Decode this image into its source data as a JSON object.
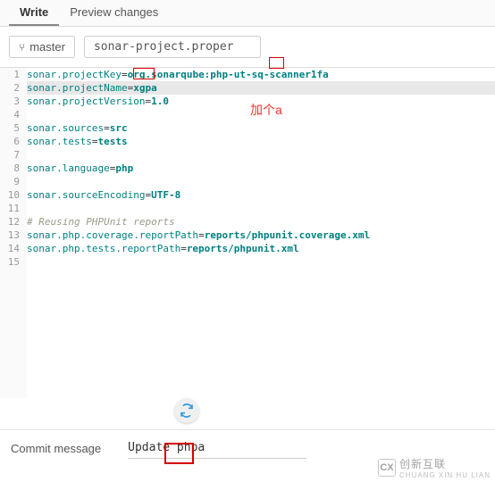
{
  "tabs": {
    "write": "Write",
    "preview": "Preview changes"
  },
  "toolbar": {
    "branch_icon": "⑂",
    "branch": "master",
    "filename": "sonar-project.proper"
  },
  "editor": {
    "lines": [
      {
        "num": "1",
        "key": "sonar.projectKey",
        "val": "org.sonarqube:php-ut-sq-scanner1fa",
        "hl": false
      },
      {
        "num": "2",
        "key": "sonar.projectName",
        "val": "xgpa",
        "hl": true
      },
      {
        "num": "3",
        "key": "sonar.projectVersion",
        "val": "1.0",
        "hl": false
      },
      {
        "num": "4",
        "key": "",
        "val": "",
        "hl": false
      },
      {
        "num": "5",
        "key": "sonar.sources",
        "val": "src",
        "hl": false
      },
      {
        "num": "6",
        "key": "sonar.tests",
        "val": "tests",
        "hl": false
      },
      {
        "num": "7",
        "key": "",
        "val": "",
        "hl": false
      },
      {
        "num": "8",
        "key": "sonar.language",
        "val": "php",
        "hl": false
      },
      {
        "num": "9",
        "key": "",
        "val": "",
        "hl": false
      },
      {
        "num": "10",
        "key": "sonar.sourceEncoding",
        "val": "UTF-8",
        "hl": false
      },
      {
        "num": "11",
        "key": "",
        "val": "",
        "hl": false
      },
      {
        "num": "12",
        "comment": "# Reusing PHPUnit reports",
        "hl": false
      },
      {
        "num": "13",
        "key": "sonar.php.coverage.reportPath",
        "val": "reports/phpunit.coverage.xml",
        "hl": false
      },
      {
        "num": "14",
        "key": "sonar.php.tests.reportPath",
        "val": "reports/phpunit.xml",
        "hl": false
      },
      {
        "num": "15",
        "key": "",
        "val": "",
        "hl": false
      }
    ]
  },
  "annotation": "加个a",
  "commit": {
    "label": "Commit message",
    "value": "Update phpa"
  },
  "logo": {
    "badge": "CX",
    "cn": "创新互联",
    "sub": "CHUANG XIN HU LIAN"
  }
}
